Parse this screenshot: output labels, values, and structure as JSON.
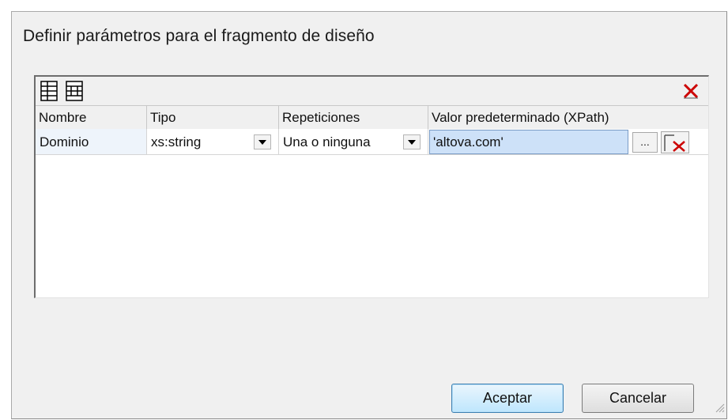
{
  "dialog": {
    "title": "Definir parámetros para el fragmento de diseño"
  },
  "toolbar": {
    "insert_icon": "insert-row-icon",
    "append_icon": "append-row-icon",
    "delete_icon": "delete-x-icon"
  },
  "grid": {
    "columns": [
      "Nombre",
      "Tipo",
      "Repeticiones",
      "Valor predeterminado (XPath)"
    ],
    "rows": [
      {
        "name": "Dominio",
        "type": "xs:string",
        "occurrence": "Una o ninguna",
        "default_value": "'altova.com'",
        "browse_label": "..."
      }
    ]
  },
  "buttons": {
    "ok": "Aceptar",
    "cancel": "Cancelar"
  },
  "colors": {
    "selected_cell": "#cde1f8",
    "delete_red": "#cc0000",
    "dialog_bg": "#f0f0f0"
  }
}
